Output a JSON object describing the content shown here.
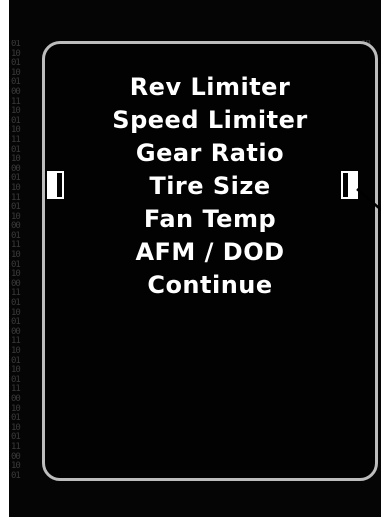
{
  "menu": {
    "items": [
      {
        "label": "Rev Limiter"
      },
      {
        "label": "Speed Limiter"
      },
      {
        "label": "Gear Ratio"
      },
      {
        "label": "Tire Size"
      },
      {
        "label": "Fan Temp"
      },
      {
        "label": "AFM / DOD"
      },
      {
        "label": "Continue"
      }
    ],
    "selected_index": 3
  },
  "colors": {
    "background": "#050505",
    "text": "#ffffff",
    "panel_border": "#bdbdbd",
    "binary_text": "#3a3a3a"
  },
  "icons": {
    "selection_left": "left-bracket-icon",
    "selection_right": "right-bracket-icon",
    "callout": "callout-line-icon"
  }
}
